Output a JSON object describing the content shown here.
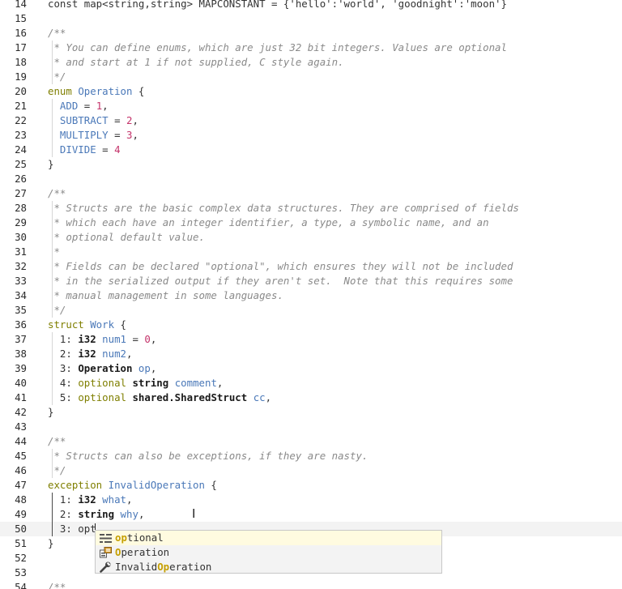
{
  "editor": {
    "lines": [
      {
        "n": "14",
        "seg": [
          {
            "c": "t-plain",
            "t": "const map<string,string> MAPCONSTANT = {'hello':'world', 'goodnight':'moon'}"
          }
        ]
      },
      {
        "n": "15",
        "seg": []
      },
      {
        "n": "16",
        "seg": [
          {
            "c": "t-comment",
            "t": "/**"
          }
        ]
      },
      {
        "n": "17",
        "seg": [
          {
            "c": "t-comment",
            "t": " * You can define enums, which are just 32 bit integers. Values are optional"
          }
        ]
      },
      {
        "n": "18",
        "seg": [
          {
            "c": "t-comment",
            "t": " * and start at 1 if not supplied, C style again."
          }
        ]
      },
      {
        "n": "19",
        "seg": [
          {
            "c": "t-comment",
            "t": " */"
          }
        ]
      },
      {
        "n": "20",
        "seg": [
          {
            "c": "t-keyword",
            "t": "enum "
          },
          {
            "c": "t-name",
            "t": "Operation"
          },
          {
            "c": "t-plain",
            "t": " {"
          }
        ]
      },
      {
        "n": "21",
        "seg": [
          {
            "c": "t-field",
            "t": "  ADD"
          },
          {
            "c": "t-plain",
            "t": " = "
          },
          {
            "c": "t-number",
            "t": "1"
          },
          {
            "c": "t-plain",
            "t": ","
          }
        ]
      },
      {
        "n": "22",
        "seg": [
          {
            "c": "t-field",
            "t": "  SUBTRACT"
          },
          {
            "c": "t-plain",
            "t": " = "
          },
          {
            "c": "t-number",
            "t": "2"
          },
          {
            "c": "t-plain",
            "t": ","
          }
        ]
      },
      {
        "n": "23",
        "seg": [
          {
            "c": "t-field",
            "t": "  MULTIPLY"
          },
          {
            "c": "t-plain",
            "t": " = "
          },
          {
            "c": "t-number",
            "t": "3"
          },
          {
            "c": "t-plain",
            "t": ","
          }
        ]
      },
      {
        "n": "24",
        "seg": [
          {
            "c": "t-field",
            "t": "  DIVIDE"
          },
          {
            "c": "t-plain",
            "t": " = "
          },
          {
            "c": "t-number",
            "t": "4"
          }
        ]
      },
      {
        "n": "25",
        "seg": [
          {
            "c": "t-plain",
            "t": "}"
          }
        ]
      },
      {
        "n": "26",
        "seg": []
      },
      {
        "n": "27",
        "seg": [
          {
            "c": "t-comment",
            "t": "/**"
          }
        ]
      },
      {
        "n": "28",
        "seg": [
          {
            "c": "t-comment",
            "t": " * Structs are the basic complex data structures. They are comprised of fields"
          }
        ]
      },
      {
        "n": "29",
        "seg": [
          {
            "c": "t-comment",
            "t": " * which each have an integer identifier, a type, a symbolic name, and an"
          }
        ]
      },
      {
        "n": "30",
        "seg": [
          {
            "c": "t-comment",
            "t": " * optional default value."
          }
        ]
      },
      {
        "n": "31",
        "seg": [
          {
            "c": "t-comment",
            "t": " *"
          }
        ]
      },
      {
        "n": "32",
        "seg": [
          {
            "c": "t-comment",
            "t": " * Fields can be declared \"optional\", which ensures they will not be included"
          }
        ]
      },
      {
        "n": "33",
        "seg": [
          {
            "c": "t-comment",
            "t": " * in the serialized output if they aren't set.  Note that this requires some"
          }
        ]
      },
      {
        "n": "34",
        "seg": [
          {
            "c": "t-comment",
            "t": " * manual management in some languages."
          }
        ]
      },
      {
        "n": "35",
        "seg": [
          {
            "c": "t-comment",
            "t": " */"
          }
        ]
      },
      {
        "n": "36",
        "seg": [
          {
            "c": "t-keyword",
            "t": "struct "
          },
          {
            "c": "t-name",
            "t": "Work"
          },
          {
            "c": "t-plain",
            "t": " {"
          }
        ]
      },
      {
        "n": "37",
        "seg": [
          {
            "c": "t-plain",
            "t": "  1: "
          },
          {
            "c": "t-type",
            "t": "i32"
          },
          {
            "c": "t-plain",
            "t": " "
          },
          {
            "c": "t-field",
            "t": "num1"
          },
          {
            "c": "t-plain",
            "t": " = "
          },
          {
            "c": "t-number",
            "t": "0"
          },
          {
            "c": "t-plain",
            "t": ","
          }
        ]
      },
      {
        "n": "38",
        "seg": [
          {
            "c": "t-plain",
            "t": "  2: "
          },
          {
            "c": "t-type",
            "t": "i32"
          },
          {
            "c": "t-plain",
            "t": " "
          },
          {
            "c": "t-field",
            "t": "num2"
          },
          {
            "c": "t-plain",
            "t": ","
          }
        ]
      },
      {
        "n": "39",
        "seg": [
          {
            "c": "t-plain",
            "t": "  3: "
          },
          {
            "c": "t-type",
            "t": "Operation"
          },
          {
            "c": "t-plain",
            "t": " "
          },
          {
            "c": "t-field",
            "t": "op"
          },
          {
            "c": "t-plain",
            "t": ","
          }
        ]
      },
      {
        "n": "40",
        "seg": [
          {
            "c": "t-plain",
            "t": "  4: "
          },
          {
            "c": "t-keyword",
            "t": "optional"
          },
          {
            "c": "t-plain",
            "t": " "
          },
          {
            "c": "t-type",
            "t": "string"
          },
          {
            "c": "t-plain",
            "t": " "
          },
          {
            "c": "t-field",
            "t": "comment"
          },
          {
            "c": "t-plain",
            "t": ","
          }
        ]
      },
      {
        "n": "41",
        "seg": [
          {
            "c": "t-plain",
            "t": "  5: "
          },
          {
            "c": "t-keyword",
            "t": "optional"
          },
          {
            "c": "t-plain",
            "t": " "
          },
          {
            "c": "t-type",
            "t": "shared.SharedStruct"
          },
          {
            "c": "t-plain",
            "t": " "
          },
          {
            "c": "t-field",
            "t": "cc"
          },
          {
            "c": "t-plain",
            "t": ","
          }
        ]
      },
      {
        "n": "42",
        "seg": [
          {
            "c": "t-plain",
            "t": "}"
          }
        ]
      },
      {
        "n": "43",
        "seg": []
      },
      {
        "n": "44",
        "seg": [
          {
            "c": "t-comment",
            "t": "/**"
          }
        ]
      },
      {
        "n": "45",
        "seg": [
          {
            "c": "t-comment",
            "t": " * Structs can also be exceptions, if they are nasty."
          }
        ]
      },
      {
        "n": "46",
        "seg": [
          {
            "c": "t-comment",
            "t": " */"
          }
        ]
      },
      {
        "n": "47",
        "seg": [
          {
            "c": "t-keyword",
            "t": "exception "
          },
          {
            "c": "t-name",
            "t": "InvalidOperation"
          },
          {
            "c": "t-plain",
            "t": " {"
          }
        ]
      },
      {
        "n": "48",
        "seg": [
          {
            "c": "t-plain",
            "t": "  1: "
          },
          {
            "c": "t-type",
            "t": "i32"
          },
          {
            "c": "t-plain",
            "t": " "
          },
          {
            "c": "t-field",
            "t": "what"
          },
          {
            "c": "t-plain",
            "t": ","
          }
        ]
      },
      {
        "n": "49",
        "seg": [
          {
            "c": "t-plain",
            "t": "  2: "
          },
          {
            "c": "t-type",
            "t": "string"
          },
          {
            "c": "t-plain",
            "t": " "
          },
          {
            "c": "t-field",
            "t": "why"
          },
          {
            "c": "t-plain",
            "t": ","
          }
        ]
      },
      {
        "n": "50",
        "seg": [
          {
            "c": "t-plain",
            "t": "  3: opt"
          }
        ]
      },
      {
        "n": "51",
        "seg": [
          {
            "c": "t-plain",
            "t": "}"
          }
        ]
      },
      {
        "n": "52",
        "seg": []
      },
      {
        "n": "53",
        "seg": []
      },
      {
        "n": "54",
        "seg": [
          {
            "c": "t-comment",
            "t": "/**"
          }
        ]
      }
    ],
    "current_line": "50"
  },
  "suggest": {
    "items": [
      {
        "icon": "keyword-icon",
        "match": "op",
        "rest": "tional",
        "prefix": "",
        "selected": true
      },
      {
        "icon": "enum-icon",
        "match": "O",
        "rest": "peration",
        "prefix": "",
        "selected": false
      },
      {
        "icon": "wrench-icon",
        "prefix": "Invalid",
        "match": "Op",
        "rest": "eration",
        "selected": false
      }
    ]
  }
}
